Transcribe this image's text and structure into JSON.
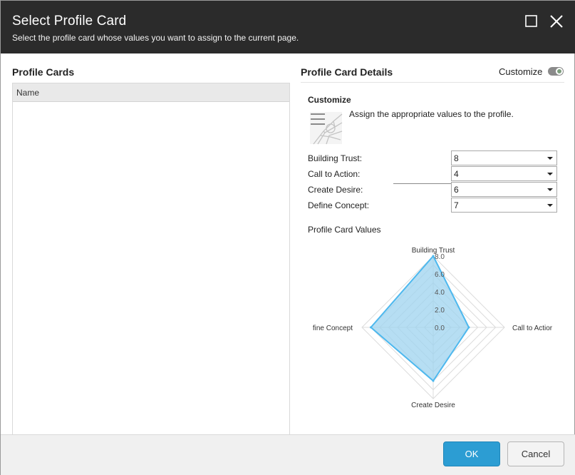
{
  "dialog": {
    "title": "Select Profile Card",
    "subtitle": "Select the profile card whose values you want to assign to the current page."
  },
  "window_controls": {
    "maximize_icon": "maximize-icon",
    "close_icon": "close-icon"
  },
  "profile_cards": {
    "title": "Profile Cards",
    "columns": [
      "Name"
    ],
    "rows": []
  },
  "details": {
    "title": "Profile Card Details",
    "customize_toggle_label": "Customize",
    "customize_toggle_on": true,
    "section_title": "Customize",
    "profile_image_icon": "profile-image-icon",
    "assign_text": "Assign the appropriate values to the profile.",
    "fields": [
      {
        "label": "Building Trust:",
        "value": "8"
      },
      {
        "label": "Call to Action:",
        "value": "4"
      },
      {
        "label": "Create Desire:",
        "value": "6"
      },
      {
        "label": "Define Concept:",
        "value": "7"
      }
    ],
    "values_title": "Profile Card Values"
  },
  "chart_data": {
    "type": "radar",
    "axes": [
      "Building Trust",
      "Call to Action",
      "Create Desire",
      "Define Concept"
    ],
    "axis_labels_visible": [
      "Building Trust",
      "Call to Actior",
      "Create Desire",
      "fine Concept"
    ],
    "values": [
      8,
      4,
      6,
      7
    ],
    "range": [
      0,
      8
    ],
    "ticks": [
      "0.0",
      "2.0",
      "4.0",
      "6.0",
      "8.0"
    ],
    "tick_values": [
      0,
      2,
      4,
      6,
      8
    ],
    "grid": true,
    "fill_color": "#9ed3ef",
    "line_color": "#4db8ee"
  },
  "footer": {
    "ok_label": "OK",
    "cancel_label": "Cancel"
  },
  "colors": {
    "titlebar": "#2b2b2b",
    "accent": "#2c9dd3"
  }
}
